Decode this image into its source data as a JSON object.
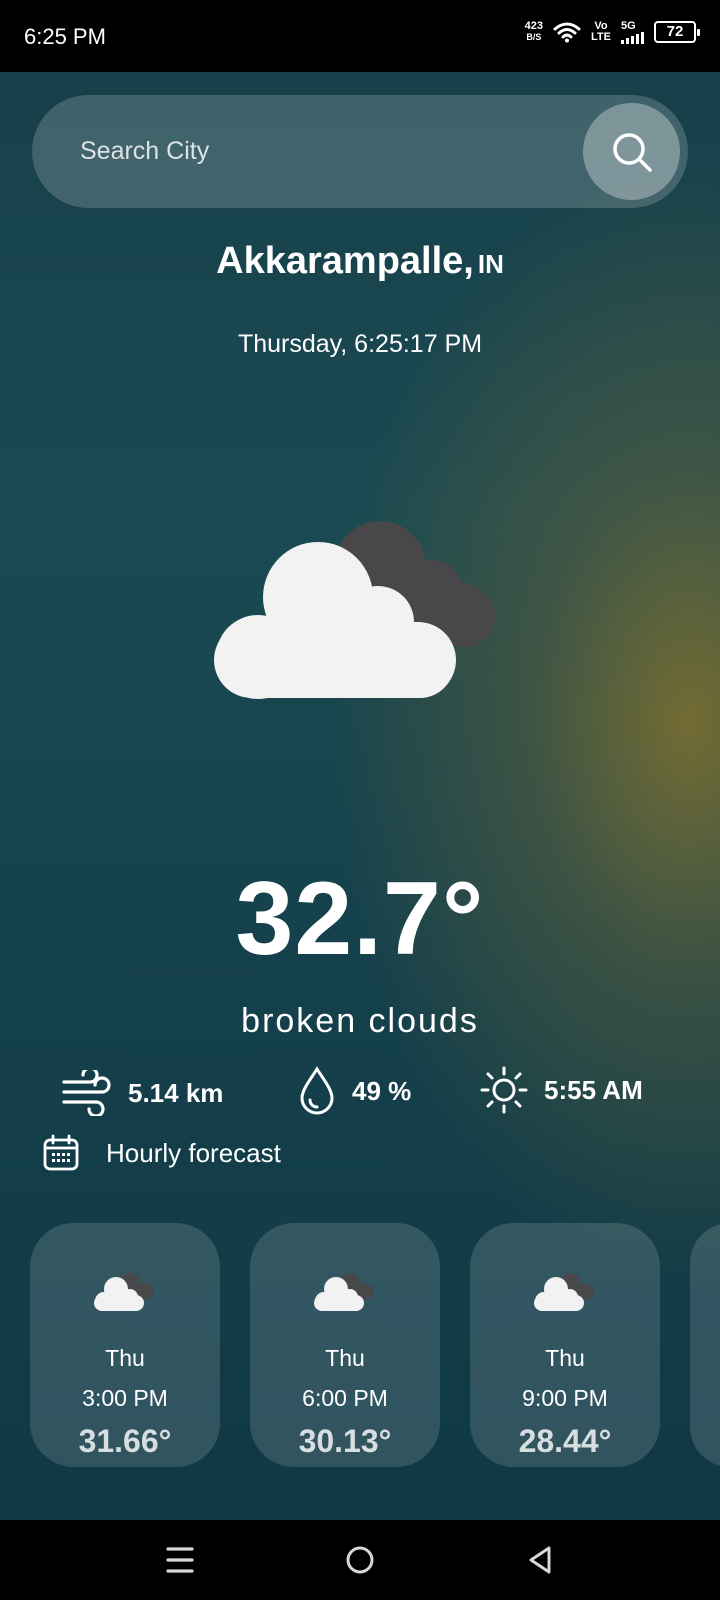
{
  "status_bar": {
    "time": "6:25 PM",
    "net_speed_value": "423",
    "net_speed_unit": "B/S",
    "volte_top": "Vo",
    "volte_bottom": "LTE",
    "network": "5G",
    "battery": "72"
  },
  "search": {
    "placeholder": "Search City",
    "icon": "search-icon"
  },
  "location": {
    "city": "Akkarampalle,",
    "country": "IN"
  },
  "datetime": "Thursday, 6:25:17 PM",
  "current": {
    "icon": "broken-clouds-icon",
    "temperature": "32.7°",
    "description": "broken clouds"
  },
  "stats": {
    "wind": {
      "icon": "wind-icon",
      "value": "5.14 km"
    },
    "humidity": {
      "icon": "humidity-icon",
      "value": "49 %"
    },
    "sunrise": {
      "icon": "sun-icon",
      "value": "5:55 AM"
    }
  },
  "hourly": {
    "title": "Hourly forecast",
    "icon": "calendar-icon",
    "items": [
      {
        "day": "Thu",
        "time": "3:00 PM",
        "temp": "31.66°",
        "icon": "broken-clouds-icon"
      },
      {
        "day": "Thu",
        "time": "6:00 PM",
        "temp": "30.13°",
        "icon": "broken-clouds-icon"
      },
      {
        "day": "Thu",
        "time": "9:00 PM",
        "temp": "28.44°",
        "icon": "broken-clouds-icon"
      }
    ]
  },
  "nav": {
    "items": [
      "menu-icon",
      "home-icon",
      "back-icon"
    ]
  },
  "colors": {
    "background_teal": "#17404a",
    "background_olive": "#787032",
    "cloud_light": "#f2f2f2",
    "cloud_dark": "#48484a"
  }
}
